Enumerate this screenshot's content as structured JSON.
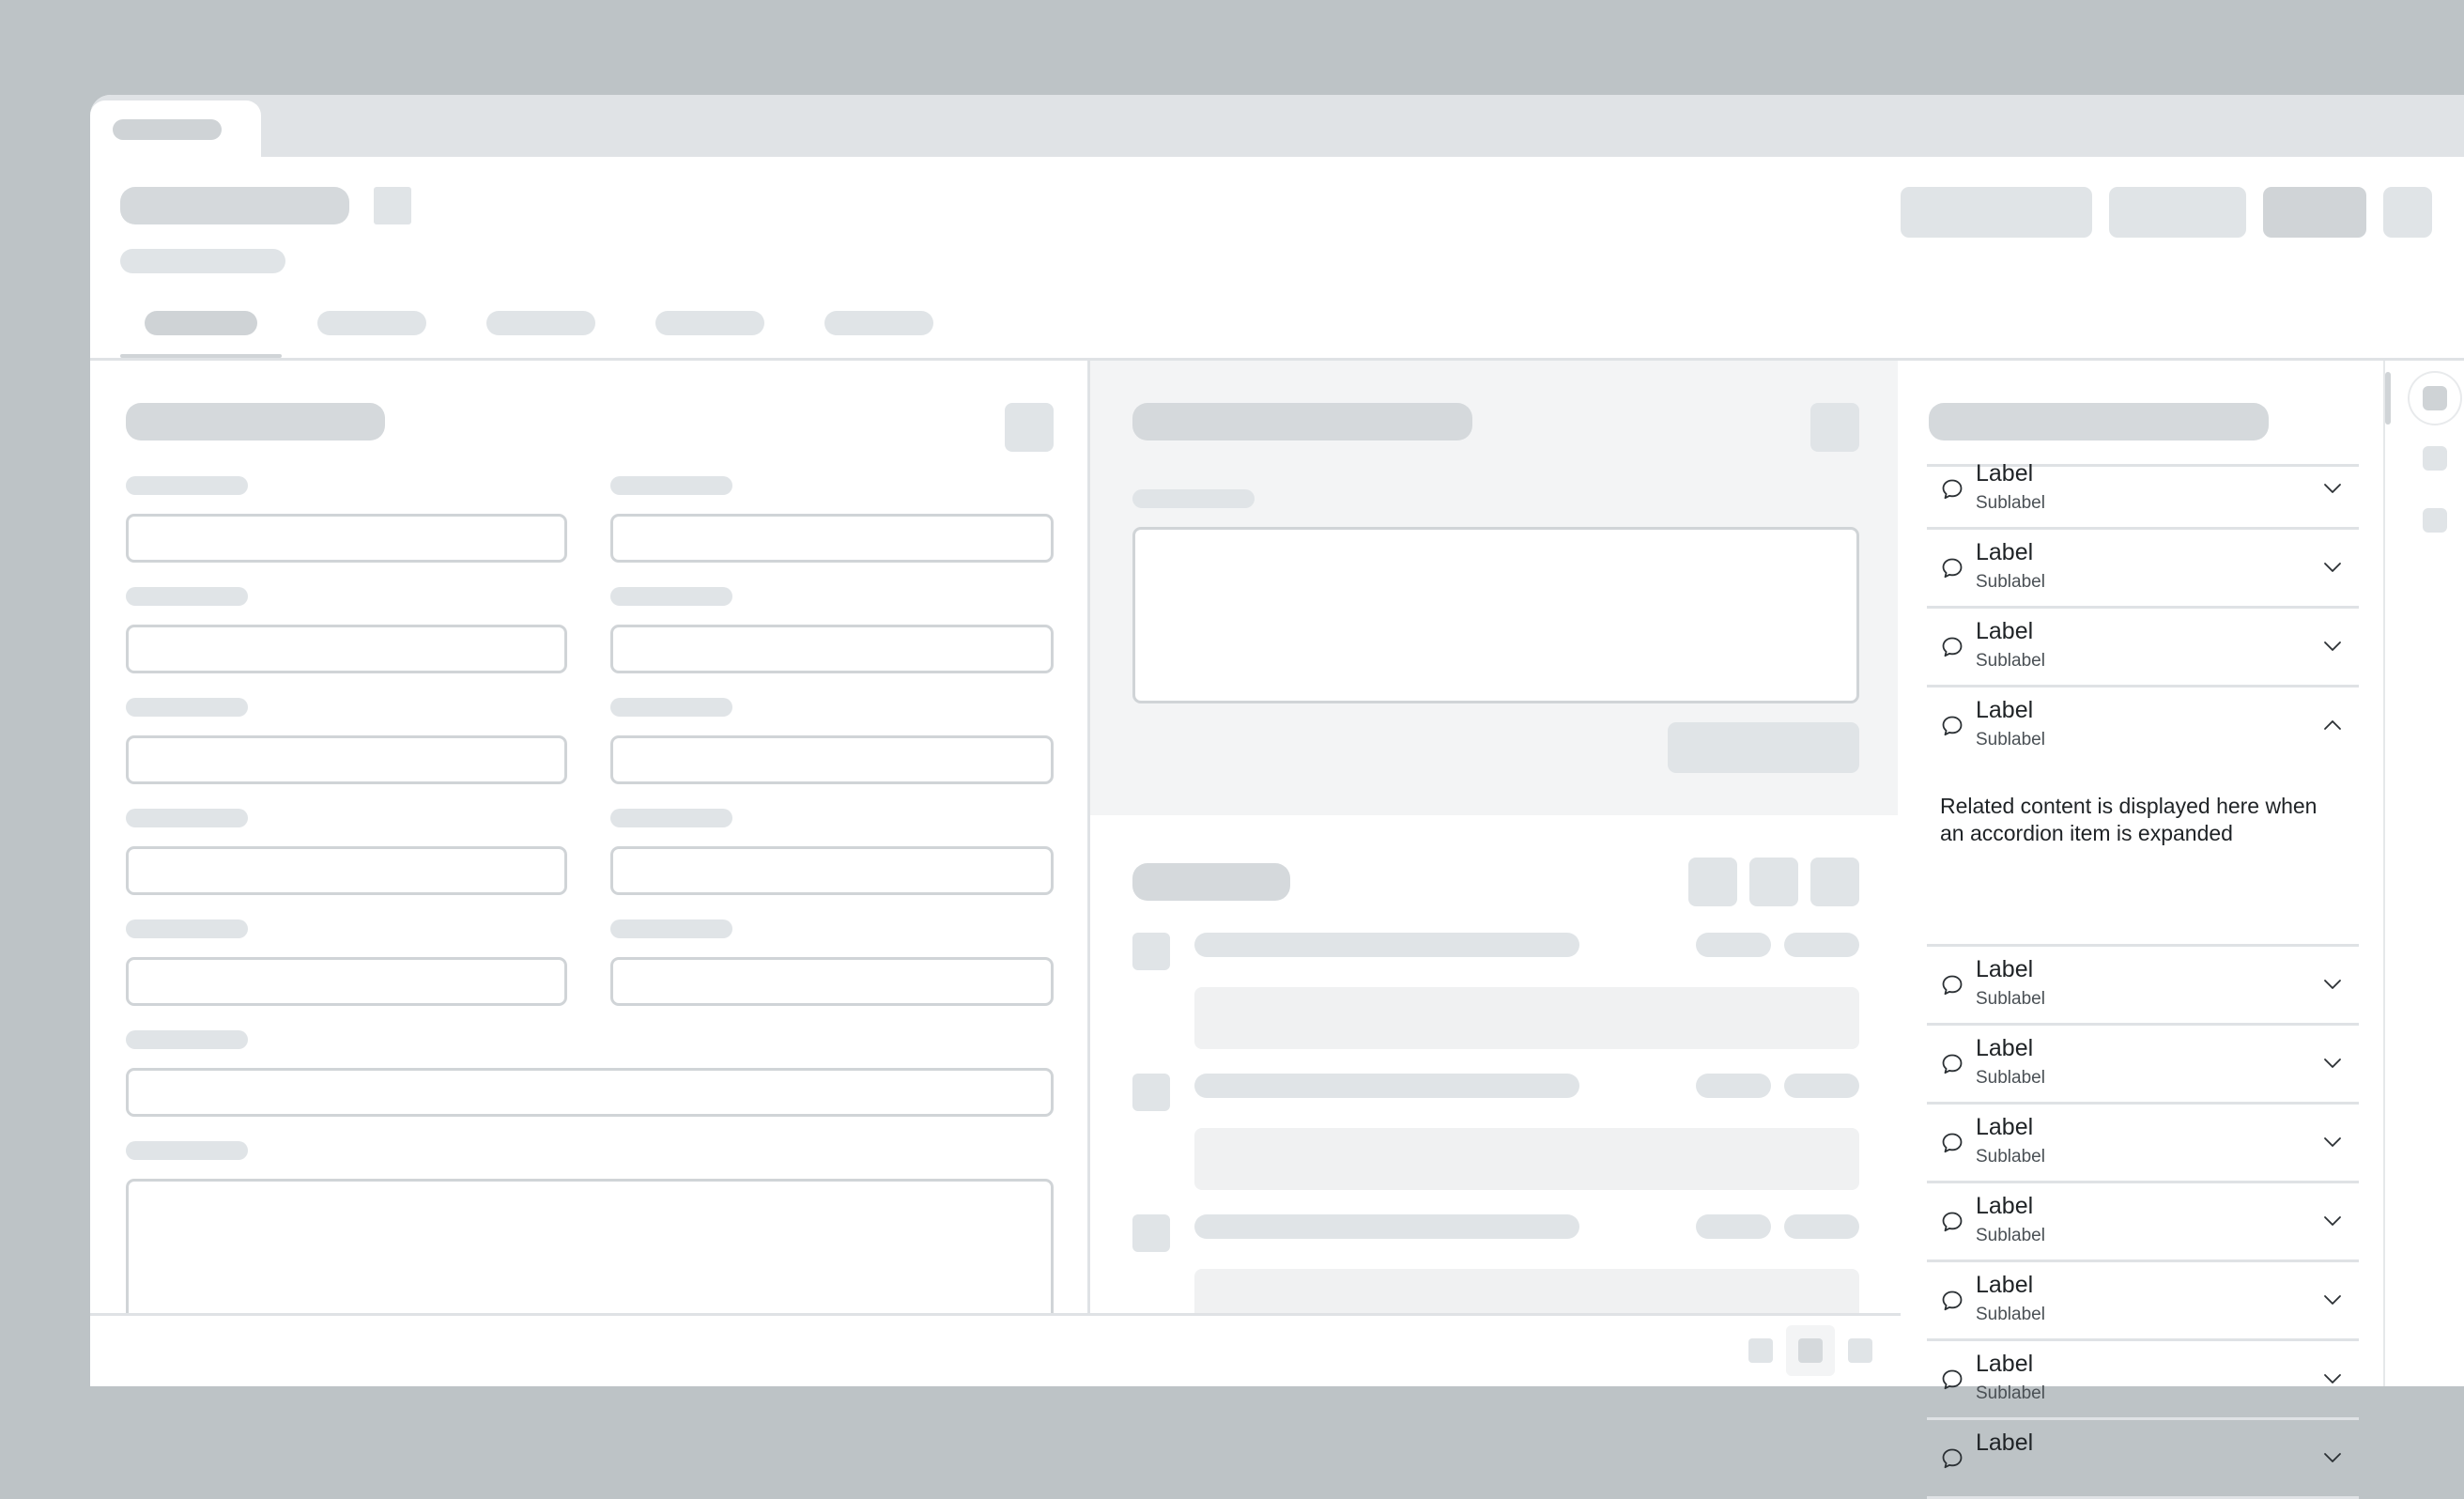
{
  "accordion": {
    "items": [
      {
        "label": "Label",
        "sublabel": "Sublabel"
      },
      {
        "label": "Label",
        "sublabel": "Sublabel"
      },
      {
        "label": "Label",
        "sublabel": "Sublabel"
      },
      {
        "label": "Label",
        "sublabel": "Sublabel",
        "expanded": true
      },
      {
        "label": "Label",
        "sublabel": "Sublabel"
      },
      {
        "label": "Label",
        "sublabel": "Sublabel"
      },
      {
        "label": "Label",
        "sublabel": "Sublabel"
      },
      {
        "label": "Label",
        "sublabel": "Sublabel"
      },
      {
        "label": "Label",
        "sublabel": "Sublabel"
      },
      {
        "label": "Label",
        "sublabel": "Sublabel"
      },
      {
        "label": "Label",
        "sublabel": ""
      }
    ],
    "expanded_content": "Related content is displayed here when an accordion item is expanded",
    "item_icon": "speech-bubble-icon",
    "collapsed_icon": "chevron-down-icon",
    "expanded_icon": "chevron-up-icon"
  },
  "colors": {
    "backdrop": "#bdc3c6",
    "placeholder": "#d5d9dc",
    "panel_tint": "#f3f4f5",
    "text": "#1f2326"
  }
}
